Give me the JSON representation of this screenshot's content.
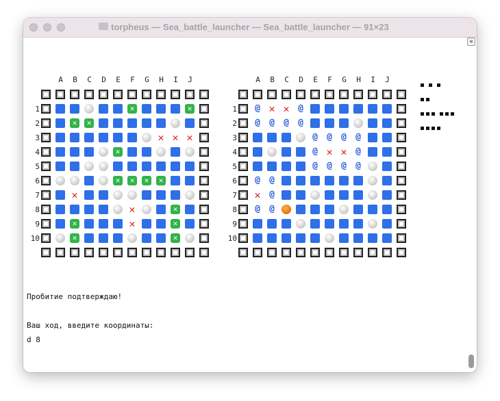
{
  "window": {
    "title": "torpheus — Sea_battle_launcher — Sea_battle_launcher — 91×23"
  },
  "columns": [
    "A",
    "B",
    "C",
    "D",
    "E",
    "F",
    "G",
    "H",
    "I",
    "J"
  ],
  "rows": [
    "1",
    "2",
    "3",
    "4",
    "5",
    "6",
    "7",
    "8",
    "9",
    "10"
  ],
  "legend": {
    "frame": "border square",
    "water": "blue square",
    "miss": "white circle",
    "hit": "red cross",
    "sunk": "green cross box",
    "spiral": "cyclone",
    "orange": "orange circle"
  },
  "own_board": [
    [
      "W",
      "W",
      "M",
      "W",
      "W",
      "S",
      "W",
      "W",
      "W",
      "S"
    ],
    [
      "W",
      "S",
      "S",
      "W",
      "W",
      "W",
      "W",
      "W",
      "M",
      "W"
    ],
    [
      "W",
      "W",
      "W",
      "W",
      "W",
      "W",
      "M",
      "X",
      "X",
      "X"
    ],
    [
      "W",
      "W",
      "W",
      "M",
      "S",
      "W",
      "W",
      "M",
      "W",
      "M"
    ],
    [
      "W",
      "W",
      "M",
      "M",
      "W",
      "W",
      "W",
      "W",
      "W",
      "W"
    ],
    [
      "M",
      "M",
      "W",
      "M",
      "S",
      "S",
      "S",
      "S",
      "W",
      "W"
    ],
    [
      "W",
      "X",
      "W",
      "W",
      "M",
      "M",
      "W",
      "W",
      "W",
      "M"
    ],
    [
      "W",
      "W",
      "W",
      "W",
      "M",
      "X",
      "M",
      "W",
      "S",
      "W"
    ],
    [
      "W",
      "S",
      "W",
      "W",
      "W",
      "X",
      "W",
      "W",
      "S",
      "W"
    ],
    [
      "M",
      "S",
      "W",
      "W",
      "W",
      "M",
      "W",
      "W",
      "S",
      "M"
    ]
  ],
  "enemy_board": [
    [
      "C",
      "X",
      "X",
      "C",
      "W",
      "W",
      "W",
      "W",
      "W",
      "W"
    ],
    [
      "C",
      "C",
      "C",
      "C",
      "W",
      "W",
      "W",
      "M",
      "W",
      "W"
    ],
    [
      "W",
      "W",
      "W",
      "M",
      "C",
      "C",
      "C",
      "C",
      "W",
      "W"
    ],
    [
      "W",
      "M",
      "W",
      "W",
      "C",
      "X",
      "X",
      "C",
      "W",
      "W"
    ],
    [
      "W",
      "W",
      "W",
      "W",
      "C",
      "C",
      "C",
      "C",
      "M",
      "W"
    ],
    [
      "C",
      "C",
      "W",
      "W",
      "W",
      "W",
      "W",
      "W",
      "M",
      "W"
    ],
    [
      "X",
      "C",
      "W",
      "W",
      "M",
      "W",
      "W",
      "W",
      "M",
      "W"
    ],
    [
      "C",
      "C",
      "O",
      "W",
      "W",
      "W",
      "M",
      "W",
      "W",
      "W"
    ],
    [
      "W",
      "W",
      "W",
      "M",
      "W",
      "W",
      "W",
      "W",
      "M",
      "W"
    ],
    [
      "W",
      "W",
      "W",
      "W",
      "W",
      "M",
      "W",
      "W",
      "W",
      "W"
    ]
  ],
  "remaining_ships": [
    [
      1,
      1,
      1
    ],
    [
      2
    ],
    [
      3,
      3
    ],
    [
      4
    ]
  ],
  "messages": {
    "line1": "Пробитие подтверждаю!",
    "line2": "Ваш ход, введите координаты:",
    "line3": "d 8"
  }
}
